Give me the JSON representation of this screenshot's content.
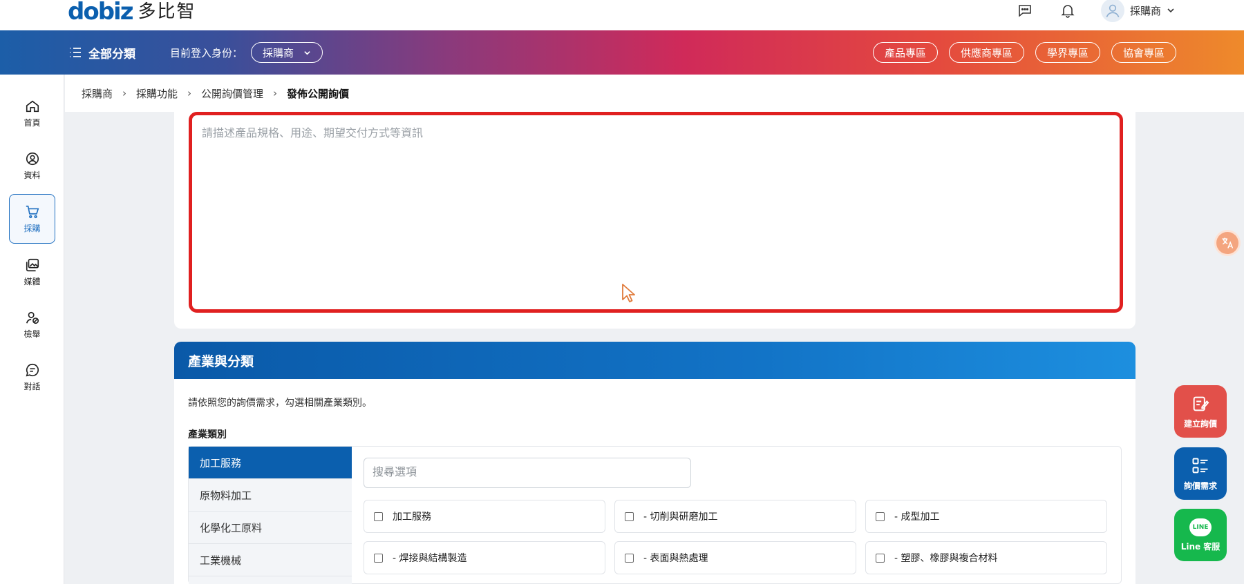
{
  "brand": {
    "mark": "dobiz",
    "name": "多比智"
  },
  "header": {
    "user_name": "採購商"
  },
  "nav": {
    "all_categories": "全部分類",
    "identity_label": "目前登入身份：",
    "identity_value": "採購商",
    "zones": [
      "產品專區",
      "供應商專區",
      "學界專區",
      "協會專區"
    ]
  },
  "sidebar": {
    "items": [
      {
        "label": "首頁",
        "icon": "home-icon"
      },
      {
        "label": "資料",
        "icon": "user-circle-icon"
      },
      {
        "label": "採購",
        "icon": "cart-icon"
      },
      {
        "label": "媒體",
        "icon": "media-icon"
      },
      {
        "label": "檢舉",
        "icon": "report-user-icon"
      },
      {
        "label": "對話",
        "icon": "chat-icon"
      }
    ]
  },
  "breadcrumb": [
    "採購商",
    "採購功能",
    "公開詢價管理",
    "發佈公開詢價"
  ],
  "description": {
    "placeholder": "請描述產品規格、用途、期望交付方式等資訊"
  },
  "industry": {
    "title": "產業與分類",
    "instruction": "請依照您的詢價需求，勾選相關產業類別。",
    "label": "產業類別",
    "categories": [
      "加工服務",
      "原物料加工",
      "化學化工原料",
      "工業機械"
    ],
    "search_placeholder": "搜尋選項",
    "options": [
      "加工服務",
      "- 切削與研磨加工",
      "- 成型加工",
      "- 焊接與結構製造",
      "- 表面與熱處理",
      "- 塑膠、橡膠與複合材料"
    ]
  },
  "floating": {
    "create_inquiry": "建立詢價",
    "inquiry_needs": "詢價需求",
    "line_service": "Line 客服",
    "line_badge": "LINE"
  },
  "colors": {
    "accent_blue": "#0b5fae",
    "highlight_red": "#e02020",
    "create_btn": "#e2504a",
    "needs_btn": "#0b5fae",
    "line_btn": "#16b84d"
  }
}
